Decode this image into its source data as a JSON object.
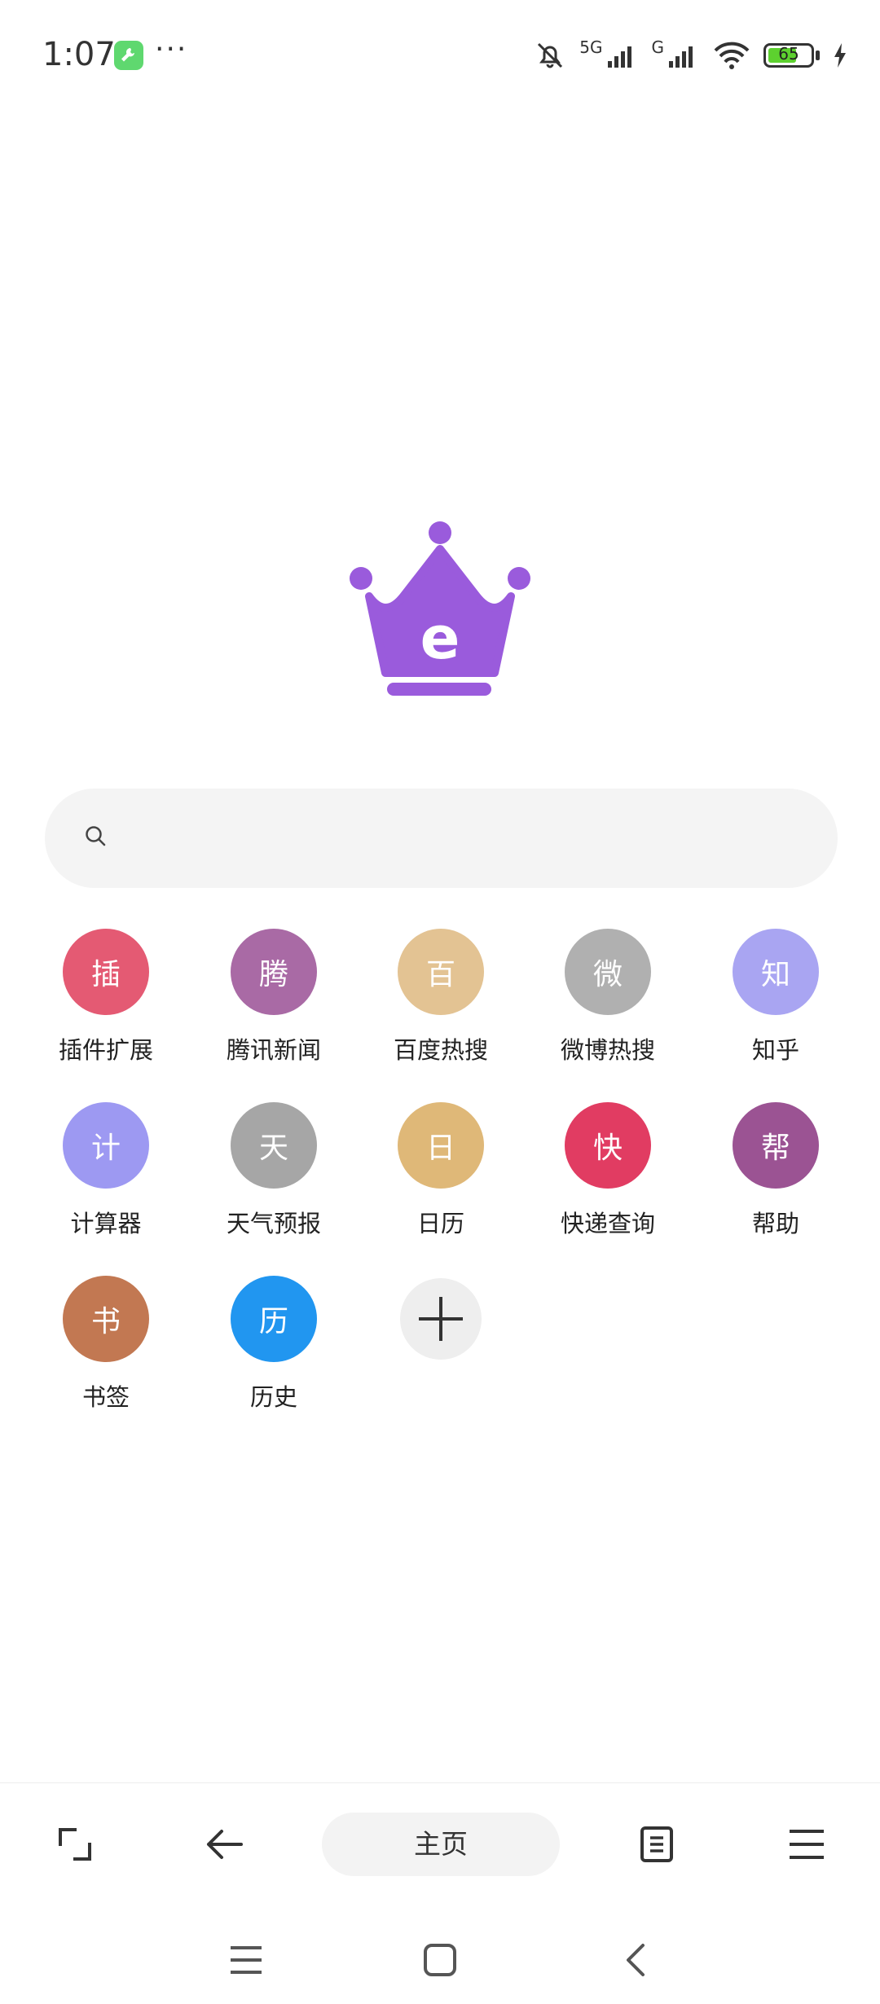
{
  "status": {
    "time": "1:07",
    "more": "···",
    "signal_1_label": "5G",
    "signal_2_label": "G",
    "battery": "65"
  },
  "logo": {
    "letter": "e",
    "color": "#9a5bdc"
  },
  "search": {
    "placeholder": ""
  },
  "shortcuts": [
    {
      "glyph": "插",
      "label": "插件扩展",
      "color": "#e45a73"
    },
    {
      "glyph": "腾",
      "label": "腾讯新闻",
      "color": "#a96aa5"
    },
    {
      "glyph": "百",
      "label": "百度热搜",
      "color": "#e3c393"
    },
    {
      "glyph": "微",
      "label": "微博热搜",
      "color": "#b0b0b0"
    },
    {
      "glyph": "知",
      "label": "知乎",
      "color": "#a9a5f2"
    },
    {
      "glyph": "计",
      "label": "计算器",
      "color": "#9d99f2"
    },
    {
      "glyph": "天",
      "label": "天气预报",
      "color": "#a6a6a6"
    },
    {
      "glyph": "日",
      "label": "日历",
      "color": "#dfb878"
    },
    {
      "glyph": "快",
      "label": "快递查询",
      "color": "#e13c62"
    },
    {
      "glyph": "帮",
      "label": "帮助",
      "color": "#9b5393"
    },
    {
      "glyph": "书",
      "label": "书签",
      "color": "#c27852"
    },
    {
      "glyph": "历",
      "label": "历史",
      "color": "#2196f0"
    }
  ],
  "toolbar": {
    "home_label": "主页"
  }
}
